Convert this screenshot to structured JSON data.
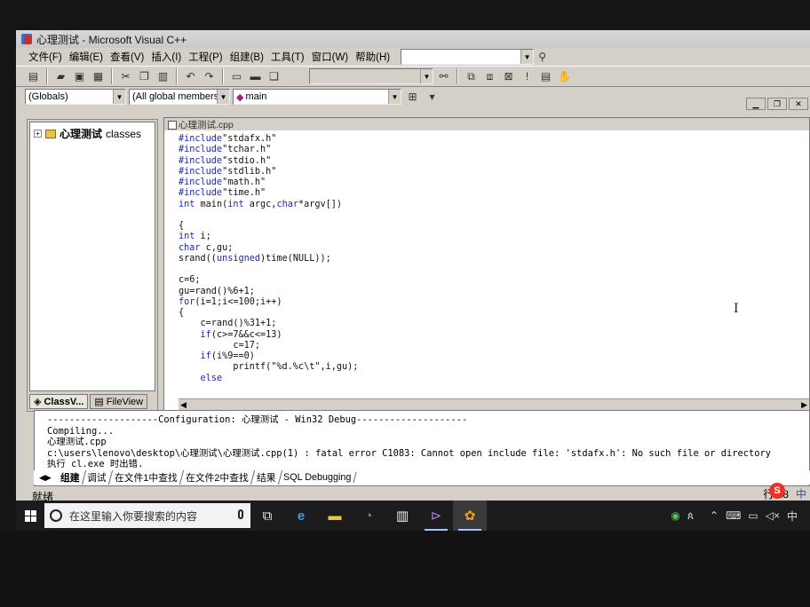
{
  "window": {
    "title": "心理测试 - Microsoft Visual C++"
  },
  "menu": [
    "文件(F)",
    "编辑(E)",
    "查看(V)",
    "插入(I)",
    "工程(P)",
    "组建(B)",
    "工具(T)",
    "窗口(W)",
    "帮助(H)"
  ],
  "wizard_bar": {
    "scope": "(Globals)",
    "members": "(All global members",
    "function": "main"
  },
  "workspace": {
    "root_label": "心理测试",
    "root_suffix": "classes",
    "tabs": [
      "ClassV...",
      "FileView"
    ]
  },
  "editor": {
    "file_name": "心理测试.cpp",
    "code_lines": [
      [
        [
          "kw",
          "#include"
        ],
        [
          "",
          "\"stdafx.h\""
        ]
      ],
      [
        [
          "kw",
          "#include"
        ],
        [
          "",
          "\"tchar.h\""
        ]
      ],
      [
        [
          "kw",
          "#include"
        ],
        [
          "",
          "\"stdio.h\""
        ]
      ],
      [
        [
          "kw",
          "#include"
        ],
        [
          "",
          "\"stdlib.h\""
        ]
      ],
      [
        [
          "kw",
          "#include"
        ],
        [
          "",
          "\"math.h\""
        ]
      ],
      [
        [
          "kw",
          "#include"
        ],
        [
          "",
          "\"time.h\""
        ]
      ],
      [
        [
          "kw",
          "int"
        ],
        [
          "",
          " main("
        ],
        [
          "kw",
          "int"
        ],
        [
          "",
          " argc,"
        ],
        [
          "kw",
          "char"
        ],
        [
          "",
          "*argv[])"
        ]
      ],
      [
        [
          "",
          ""
        ]
      ],
      [
        [
          "",
          "{"
        ]
      ],
      [
        [
          "kw",
          "int"
        ],
        [
          "",
          " i;"
        ]
      ],
      [
        [
          "kw",
          "char"
        ],
        [
          "",
          " c,gu;"
        ]
      ],
      [
        [
          "",
          "srand(("
        ],
        [
          "kw",
          "unsigned"
        ],
        [
          "",
          ")time(NULL));"
        ]
      ],
      [
        [
          "",
          ""
        ]
      ],
      [
        [
          "",
          "c=6;"
        ]
      ],
      [
        [
          "",
          "gu=rand()%6+1;"
        ]
      ],
      [
        [
          "kw",
          "for"
        ],
        [
          "",
          "(i=1;i<=100;i++)"
        ]
      ],
      [
        [
          "",
          "{"
        ]
      ],
      [
        [
          "",
          "    c=rand()%31+1;"
        ]
      ],
      [
        [
          "",
          "    "
        ],
        [
          "kw",
          "if"
        ],
        [
          "",
          "(c>=7&&c<=13)"
        ]
      ],
      [
        [
          "",
          "          c=17;"
        ]
      ],
      [
        [
          "",
          "    "
        ],
        [
          "kw",
          "if"
        ],
        [
          "",
          "(i%9==0)"
        ]
      ],
      [
        [
          "",
          "          printf(\"%d.%c\\t\",i,gu);"
        ]
      ],
      [
        [
          "",
          "    "
        ],
        [
          "kw",
          "else"
        ]
      ]
    ]
  },
  "output": {
    "lines": [
      "--------------------Configuration: 心理测试 - Win32 Debug--------------------",
      "Compiling...",
      "心理测试.cpp",
      "c:\\users\\lenovo\\desktop\\心理测试\\心理测试.cpp(1) : fatal error C1083: Cannot open include file: 'stdafx.h': No such file or directory",
      "执行 cl.exe 时出错."
    ],
    "tabs": [
      "组建",
      "调试",
      "在文件1中查找",
      "在文件2中查找",
      "结果",
      "SQL Debugging"
    ]
  },
  "status": {
    "text": "就绪",
    "row": "行 18",
    "ime": "中"
  },
  "taskbar": {
    "search_placeholder": "在这里输入你要搜索的内容"
  }
}
